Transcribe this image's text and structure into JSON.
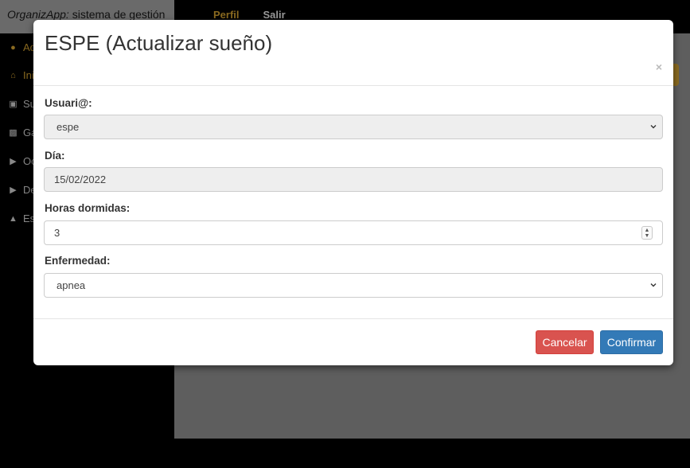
{
  "app": {
    "brand_name": "OrganizApp:",
    "brand_tagline": " sistema de gestión",
    "nav": {
      "perfil": "Perfil",
      "salir": "Salir"
    }
  },
  "sidebar": {
    "items": [
      {
        "label": "Ad",
        "icon": "user-icon"
      },
      {
        "label": "Ini",
        "icon": "home-icon"
      },
      {
        "label": "Su",
        "icon": "bed-icon"
      },
      {
        "label": "Ga",
        "icon": "money-icon"
      },
      {
        "label": "Oc",
        "icon": "youtube-icon"
      },
      {
        "label": "De",
        "icon": "play-icon"
      },
      {
        "label": "Es",
        "icon": "graduation-cap-icon"
      }
    ]
  },
  "modal": {
    "title": "ESPE (Actualizar sueño)",
    "close_label": "×",
    "fields": {
      "usuario": {
        "label": "Usuari@:",
        "value": "espe"
      },
      "dia": {
        "label": "Día:",
        "value": "15/02/2022"
      },
      "horas": {
        "label": "Horas dormidas:",
        "value": "3"
      },
      "enfermedad": {
        "label": "Enfermedad:",
        "value": "apnea"
      }
    },
    "buttons": {
      "cancel": "Cancelar",
      "confirm": "Confirmar"
    }
  },
  "colors": {
    "danger": "#d9534f",
    "primary": "#337ab7",
    "accent_gold": "#8a6a20"
  }
}
